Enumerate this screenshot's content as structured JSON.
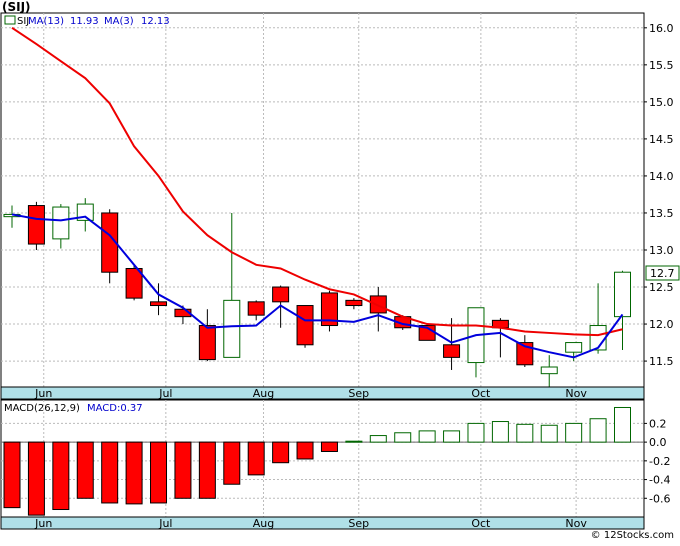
{
  "title": "(SIJ)",
  "legend": {
    "symbol": "SIJ",
    "ma13_label": "MA(13)",
    "ma13_value": "11.93",
    "ma3_label": "MA(3)",
    "ma3_value": "12.13"
  },
  "last_price_tag": "12.7",
  "macd_legend": {
    "label": "MACD(26,12,9)",
    "value_label": "MACD:0.37"
  },
  "credit": "© 12Stocks.com",
  "colors": {
    "up_candle": "#ffffff",
    "up_outline": "#006600",
    "down_candle": "#ff0000",
    "ma13": "#ee0000",
    "ma3": "#0000dd",
    "axis_band": "#b0e0e8",
    "grid": "#bbbbbb"
  },
  "chart_data": [
    {
      "type": "candlestick",
      "interval": "weekly",
      "ylim": [
        11.15,
        16.2
      ],
      "yticks": [
        11.5,
        12.0,
        12.5,
        13.0,
        13.5,
        14.0,
        14.5,
        15.0,
        15.5,
        16.0
      ],
      "ytick_labels": [
        "11.5",
        "12.0",
        "12.5",
        "13.0",
        "13.5",
        "14.0",
        "14.5",
        "15.0",
        "15.5",
        "16.0"
      ],
      "month_labels": [
        {
          "label": "Jun",
          "at": 1.3
        },
        {
          "label": "Jul",
          "at": 6.3
        },
        {
          "label": "Aug",
          "at": 10.3
        },
        {
          "label": "Sep",
          "at": 14.2
        },
        {
          "label": "Oct",
          "at": 19.2
        },
        {
          "label": "Nov",
          "at": 23.1
        }
      ],
      "vgrid_at": [
        1.3,
        6.3,
        10.3,
        14.2,
        19.2,
        23.1
      ],
      "grid": true,
      "candles": [
        {
          "o": 13.45,
          "h": 13.6,
          "l": 13.3,
          "c": 13.48
        },
        {
          "o": 13.6,
          "h": 13.65,
          "l": 13.0,
          "c": 13.08
        },
        {
          "o": 13.15,
          "h": 13.62,
          "l": 13.02,
          "c": 13.58
        },
        {
          "o": 13.4,
          "h": 13.7,
          "l": 13.25,
          "c": 13.62
        },
        {
          "o": 13.5,
          "h": 13.55,
          "l": 12.55,
          "c": 12.7
        },
        {
          "o": 12.75,
          "h": 12.8,
          "l": 12.32,
          "c": 12.35
        },
        {
          "o": 12.3,
          "h": 12.55,
          "l": 12.12,
          "c": 12.25
        },
        {
          "o": 12.2,
          "h": 12.25,
          "l": 12.0,
          "c": 12.1
        },
        {
          "o": 11.98,
          "h": 12.2,
          "l": 11.5,
          "c": 11.52
        },
        {
          "o": 11.55,
          "h": 13.5,
          "l": 11.55,
          "c": 12.32
        },
        {
          "o": 12.3,
          "h": 12.32,
          "l": 12.05,
          "c": 12.12
        },
        {
          "o": 12.5,
          "h": 12.52,
          "l": 11.95,
          "c": 12.3
        },
        {
          "o": 12.25,
          "h": 12.25,
          "l": 11.68,
          "c": 11.72
        },
        {
          "o": 12.42,
          "h": 12.45,
          "l": 11.9,
          "c": 11.98
        },
        {
          "o": 12.32,
          "h": 12.35,
          "l": 12.2,
          "c": 12.25
        },
        {
          "o": 12.38,
          "h": 12.5,
          "l": 11.9,
          "c": 12.15
        },
        {
          "o": 12.1,
          "h": 12.12,
          "l": 11.92,
          "c": 11.95
        },
        {
          "o": 11.98,
          "h": 12.0,
          "l": 11.78,
          "c": 11.78
        },
        {
          "o": 11.72,
          "h": 12.08,
          "l": 11.38,
          "c": 11.55
        },
        {
          "o": 11.48,
          "h": 12.22,
          "l": 11.28,
          "c": 12.22
        },
        {
          "o": 12.05,
          "h": 12.08,
          "l": 11.55,
          "c": 11.95
        },
        {
          "o": 11.75,
          "h": 11.85,
          "l": 11.42,
          "c": 11.45
        },
        {
          "o": 11.33,
          "h": 11.58,
          "l": 11.15,
          "c": 11.42
        },
        {
          "o": 11.62,
          "h": 11.72,
          "l": 11.5,
          "c": 11.75
        },
        {
          "o": 11.65,
          "h": 12.55,
          "l": 11.6,
          "c": 11.98
        },
        {
          "o": 12.1,
          "h": 12.72,
          "l": 11.65,
          "c": 12.7
        }
      ],
      "series": [
        {
          "name": "MA(13)",
          "color": "#ee0000",
          "values": [
            16.0,
            15.78,
            15.55,
            15.32,
            14.98,
            14.4,
            14.0,
            13.52,
            13.12,
            12.95,
            12.8,
            12.75,
            12.58,
            12.45,
            12.4,
            12.25,
            12.1,
            12.0,
            11.98,
            11.98,
            11.95,
            11.88,
            11.58,
            11.55,
            11.52,
            11.93
          ],
          "plot_from": 0,
          "plot_values": [
            16.0,
            15.78,
            15.55,
            15.32,
            14.98,
            14.4,
            14.0,
            13.52,
            13.2,
            12.97,
            12.8,
            12.75,
            12.6,
            12.47,
            12.4,
            12.25,
            12.1,
            12.0,
            11.98,
            11.98,
            11.95,
            11.9,
            11.88,
            11.86,
            11.85,
            11.93
          ]
        },
        {
          "name": "MA(3)",
          "color": "#0000dd",
          "values": [
            13.55,
            13.48,
            13.4,
            13.45,
            13.25,
            12.8,
            12.42,
            12.23,
            11.95,
            11.97,
            11.98,
            12.25,
            12.05,
            12.05,
            12.03,
            12.12,
            12.0,
            11.95,
            11.76,
            11.85,
            11.9,
            11.7,
            11.6,
            11.55,
            11.65,
            12.13
          ],
          "plot_values": [
            13.48,
            13.42,
            13.4,
            13.45,
            13.2,
            12.8,
            12.4,
            12.22,
            11.95,
            11.97,
            11.98,
            12.25,
            12.05,
            12.05,
            12.03,
            12.12,
            12.0,
            11.95,
            11.75,
            11.85,
            11.88,
            11.7,
            11.62,
            11.55,
            11.68,
            12.13
          ]
        }
      ]
    },
    {
      "type": "bar",
      "name": "MACD(26,12,9)",
      "ylim": [
        -0.8,
        0.45
      ],
      "yticks": [
        0.2,
        0.0,
        -0.2,
        -0.4,
        -0.6
      ],
      "ytick_labels": [
        "0.2",
        "0.0",
        "-0.2",
        "-0.4",
        "-0.6"
      ],
      "values": [
        -0.7,
        -0.78,
        -0.72,
        -0.6,
        -0.65,
        -0.66,
        -0.65,
        -0.6,
        -0.6,
        -0.45,
        -0.35,
        -0.22,
        -0.18,
        -0.1,
        0.01,
        0.07,
        0.1,
        0.12,
        0.12,
        0.2,
        0.22,
        0.19,
        0.18,
        0.2,
        0.25,
        0.37
      ]
    }
  ]
}
